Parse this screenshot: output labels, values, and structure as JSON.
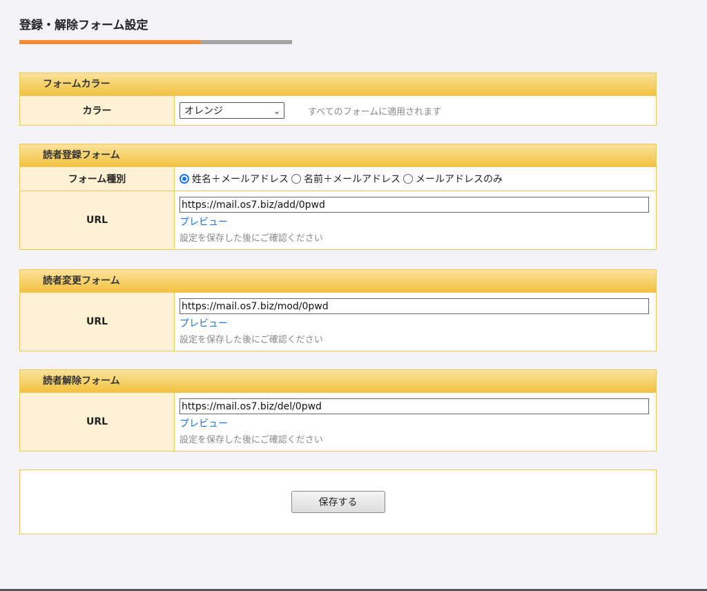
{
  "page": {
    "title": "登録・解除フォーム設定"
  },
  "form_color": {
    "header": "フォームカラー",
    "label": "カラー",
    "selected": "オレンジ",
    "note": "すべてのフォームに適用されます"
  },
  "subscribe": {
    "header": "読者登録フォーム",
    "type_label": "フォーム種別",
    "options": [
      {
        "label": "姓名＋メールアドレス",
        "checked": true
      },
      {
        "label": "名前＋メールアドレス",
        "checked": false
      },
      {
        "label": "メールアドレスのみ",
        "checked": false
      }
    ],
    "url_label": "URL",
    "url": "https://mail.os7.biz/add/0pwd",
    "preview": "プレビュー",
    "hint": "設定を保存した後にご確認ください"
  },
  "modify": {
    "header": "読者変更フォーム",
    "url_label": "URL",
    "url": "https://mail.os7.biz/mod/0pwd",
    "preview": "プレビュー",
    "hint": "設定を保存した後にご確認ください"
  },
  "unsubscribe": {
    "header": "読者解除フォーム",
    "url_label": "URL",
    "url": "https://mail.os7.biz/del/0pwd",
    "preview": "プレビュー",
    "hint": "設定を保存した後にご確認ください"
  },
  "save": {
    "label": "保存する"
  },
  "colors": {
    "accent_orange": "#f28d35",
    "header_gold": "#f2c140",
    "link_blue": "#1a73e8"
  }
}
